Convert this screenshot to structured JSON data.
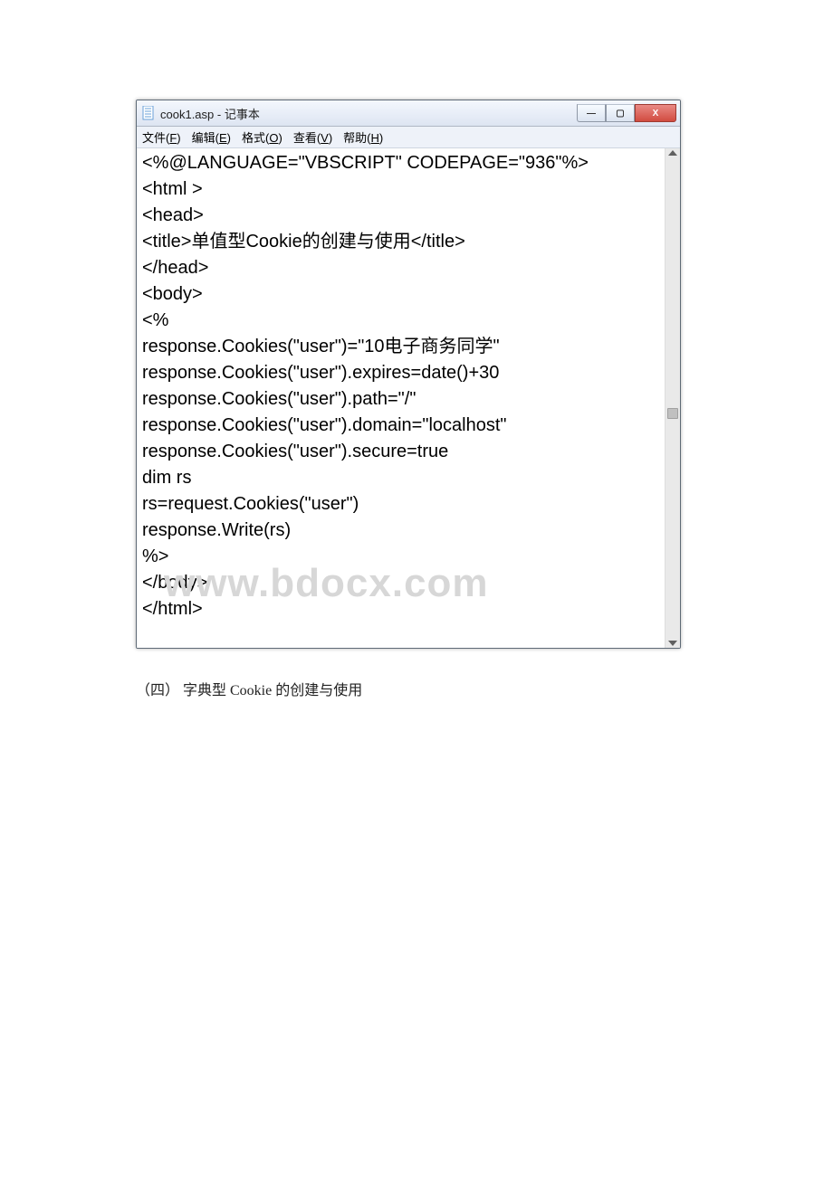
{
  "window": {
    "title": "cook1.asp - 记事本",
    "buttons": {
      "min_sym": "—",
      "max_sym": "▢",
      "close_sym": "X"
    }
  },
  "menubar": {
    "items": [
      {
        "label_pre": "文件(",
        "key": "F",
        "label_post": ")"
      },
      {
        "label_pre": "编辑(",
        "key": "E",
        "label_post": ")"
      },
      {
        "label_pre": "格式(",
        "key": "O",
        "label_post": ")"
      },
      {
        "label_pre": "查看(",
        "key": "V",
        "label_post": ")"
      },
      {
        "label_pre": "帮助(",
        "key": "H",
        "label_post": ")"
      }
    ]
  },
  "editor": {
    "content": "<%@LANGUAGE=\"VBSCRIPT\" CODEPAGE=\"936\"%>\n<html >\n<head>\n<title>单值型Cookie的创建与使用</title>\n</head>\n<body>\n<%\nresponse.Cookies(\"user\")=\"10电子商务同学\"\nresponse.Cookies(\"user\").expires=date()+30\nresponse.Cookies(\"user\").path=\"/\"\nresponse.Cookies(\"user\").domain=\"localhost\"\nresponse.Cookies(\"user\").secure=true\ndim rs\nrs=request.Cookies(\"user\")\nresponse.Write(rs)\n%>\n</body>\n</html>\n"
  },
  "watermark": "www.bdocx.com",
  "caption": "（四） 字典型 Cookie 的创建与使用"
}
